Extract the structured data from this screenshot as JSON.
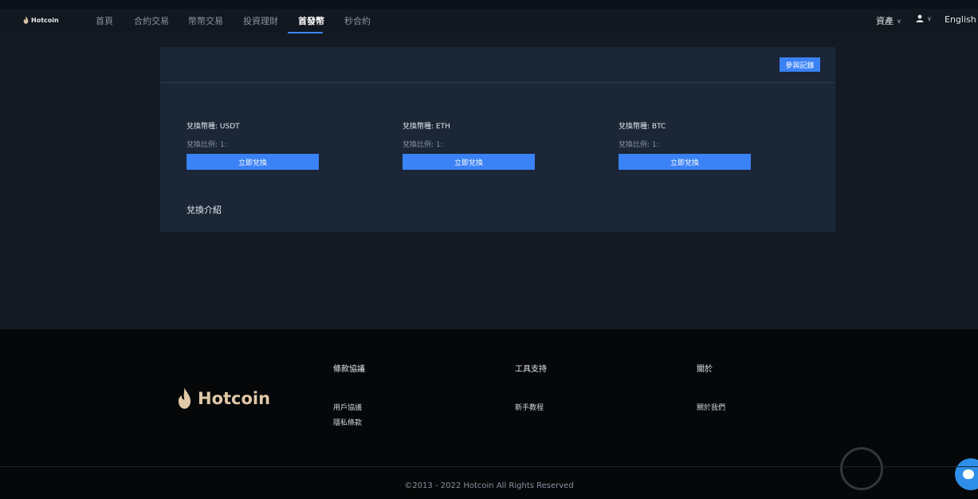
{
  "brand": {
    "name": "Hotcoin"
  },
  "nav": {
    "items": [
      {
        "label": "首頁"
      },
      {
        "label": "合約交易"
      },
      {
        "label": "幣幣交易"
      },
      {
        "label": "投資理財"
      },
      {
        "label": "首發幣",
        "active": true
      },
      {
        "label": "秒合約"
      }
    ],
    "assets_label": "資產",
    "language_label": "English"
  },
  "exchange": {
    "record_button": "參與記錄",
    "items": [
      {
        "title": "兌換幣種: USDT",
        "ratio": "兌換比例: 1:",
        "button": "立即兌換"
      },
      {
        "title": "兌換幣種: ETH",
        "ratio": "兌換比例: 1:",
        "button": "立即兌換"
      },
      {
        "title": "兌換幣種: BTC",
        "ratio": "兌換比例: 1:",
        "button": "立即兌換"
      }
    ],
    "intro_title": "兌換介紹"
  },
  "footer": {
    "logo_text": "Hotcoin",
    "columns": [
      {
        "heading": "條款協議",
        "links": [
          "用戶協議",
          "隱私條款"
        ]
      },
      {
        "heading": "工具支持",
        "links": [
          "新手教程"
        ]
      },
      {
        "heading": "關於",
        "links": [
          "關於我們"
        ]
      }
    ],
    "copyright": "©2013 - 2022 Hotcoin All Rights Reserved"
  },
  "colors": {
    "accent": "#3b82f6",
    "page_bg": "#131a24",
    "card_bg": "#1b2736",
    "footer_bg": "#050709"
  },
  "icons": {
    "user": "user-icon",
    "chevron": "chevron-down-icon",
    "flame": "hotcoin-flame-icon"
  }
}
